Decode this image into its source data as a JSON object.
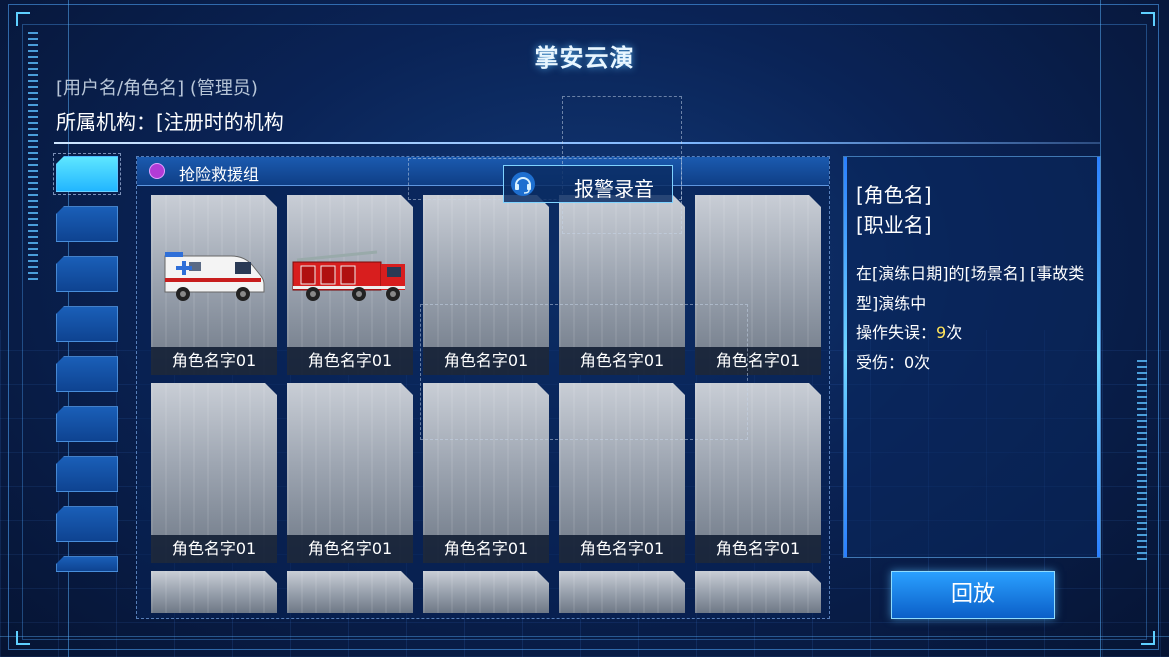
{
  "header": {
    "title": "掌安云演",
    "user_line": "[用户名/角色名] (管理员)",
    "org_line": "所属机构：[注册时的机构"
  },
  "group": {
    "label": "抢险救援组",
    "dot_color": "#b23bd6"
  },
  "alarm": {
    "label": "报警录音",
    "icon": "headset-icon"
  },
  "cards": [
    {
      "name": "角色名字01",
      "vehicle": "ambulance"
    },
    {
      "name": "角色名字01",
      "vehicle": "fire-truck"
    },
    {
      "name": "角色名字01",
      "vehicle": ""
    },
    {
      "name": "角色名字01",
      "vehicle": ""
    },
    {
      "name": "角色名字01",
      "vehicle": ""
    },
    {
      "name": "角色名字01",
      "vehicle": ""
    },
    {
      "name": "角色名字01",
      "vehicle": ""
    },
    {
      "name": "角色名字01",
      "vehicle": ""
    },
    {
      "name": "角色名字01",
      "vehicle": ""
    },
    {
      "name": "角色名字01",
      "vehicle": ""
    }
  ],
  "info": {
    "role": "[角色名]",
    "job": "[职业名]",
    "desc": "在[演练日期]的[场景名] [事故类型]演练中",
    "error_prefix": "操作失误：",
    "error_count": "9",
    "error_suffix": "次",
    "hurt": "受伤：0次"
  },
  "replay_label": "回放",
  "colors": {
    "accent": "#5fd0ff",
    "highlight": "#ffe45a",
    "active_tab": "#22b6ff"
  }
}
